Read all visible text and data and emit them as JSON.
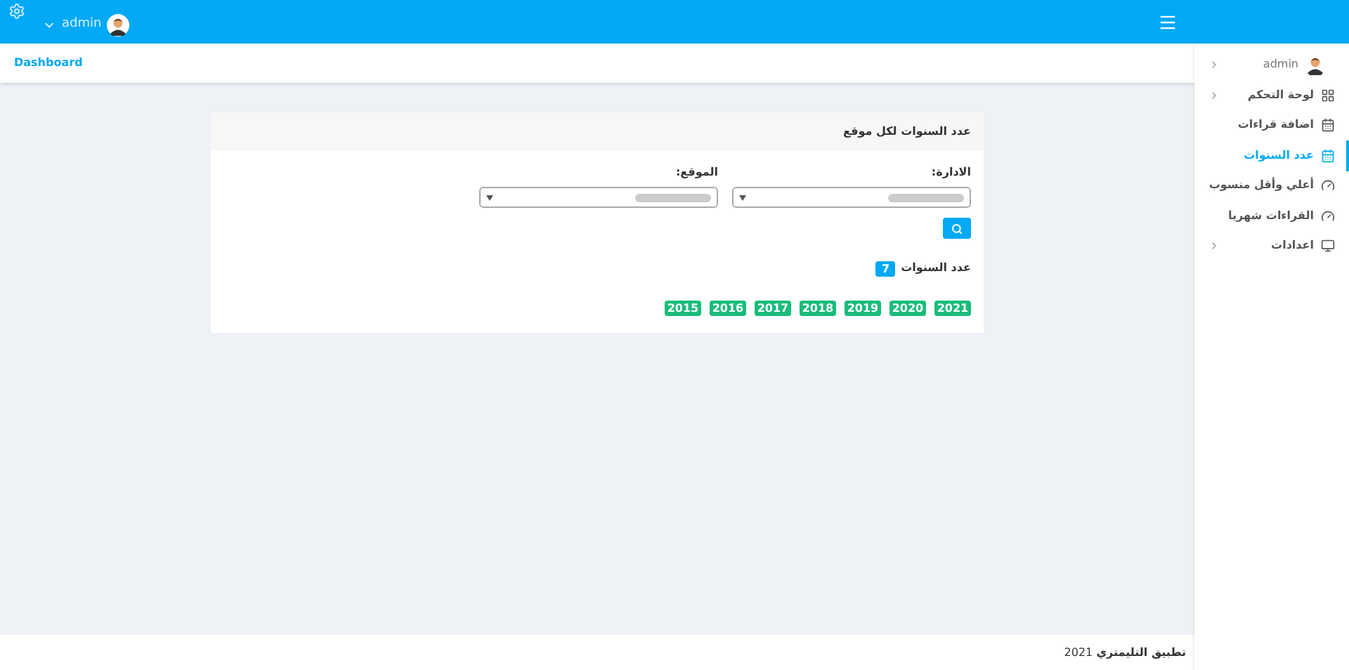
{
  "topbar": {
    "user": "admin"
  },
  "breadcrumb": "Dashboard",
  "sidebar": {
    "user": "admin",
    "items": [
      {
        "label": "لوحة التحكم",
        "kind": "grid",
        "selected": false,
        "has_children": true
      },
      {
        "label": "اضافة قراءات",
        "kind": "calendar",
        "selected": false,
        "has_children": false
      },
      {
        "label": "عدد السنوات",
        "kind": "calendar",
        "selected": true,
        "has_children": false
      },
      {
        "label": "أعلي وأقل منسوب",
        "kind": "gauge",
        "selected": false,
        "has_children": false
      },
      {
        "label": "القراءات شهريا",
        "kind": "gauge",
        "selected": false,
        "has_children": false
      },
      {
        "label": "اعدادات",
        "kind": "monitor",
        "selected": false,
        "has_children": true
      }
    ]
  },
  "card": {
    "title": "عدد السنوات لكل موقع",
    "fields": [
      {
        "label": "الادارة:"
      },
      {
        "label": "الموقع:"
      }
    ],
    "count_label": "عدد السنوات",
    "count": "7",
    "years": [
      "2021",
      "2020",
      "2019",
      "2018",
      "2017",
      "2016",
      "2015"
    ]
  },
  "footer": "**تطبيق التليمتري** 2021"
}
